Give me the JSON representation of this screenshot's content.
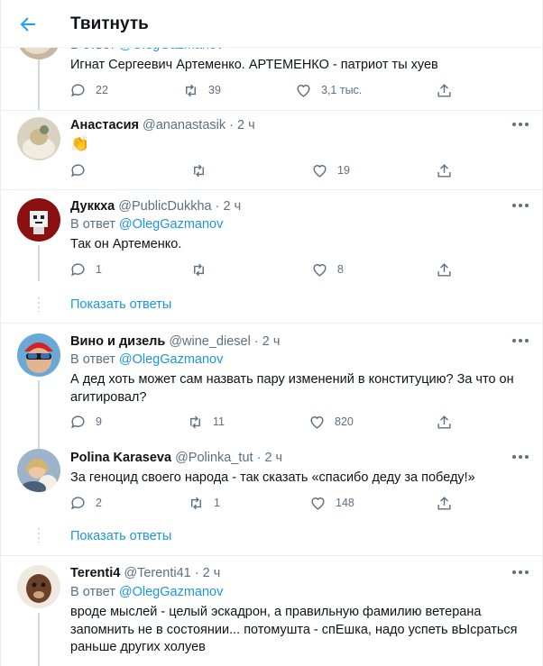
{
  "header": {
    "title": "Твитнуть"
  },
  "colors": {
    "accent": "#1da1f2",
    "link": "#1b95e0",
    "muted": "#5b7083",
    "text": "#0f1419",
    "border": "#ebeef0"
  },
  "icons": {
    "back": "arrow-left-icon",
    "more": "ellipsis-icon",
    "reply": "speech-bubble-icon",
    "retweet": "retweet-icon",
    "like": "heart-icon",
    "share": "share-icon"
  },
  "tweets": [
    {
      "reply_label": "В ответ",
      "reply_to": "@OlegGazmanov",
      "text": "Игнат Сергеевич Артеменко. АРТЕМЕНКО - патриот ты хуев",
      "replies": "22",
      "retweets": "39",
      "likes": "3,1 тыс."
    },
    {
      "name": "Анастасия",
      "handle": "@ananastasik",
      "time": "2 ч",
      "text": "👏",
      "replies": "",
      "retweets": "",
      "likes": "19"
    },
    {
      "name": "Дуккха",
      "handle": "@PublicDukkha",
      "time": "2 ч",
      "reply_label": "В ответ",
      "reply_to": "@OlegGazmanov",
      "text": "Так он Артеменко.",
      "replies": "1",
      "retweets": "",
      "likes": "8"
    },
    {
      "name": "Вино и дизель",
      "handle": "@wine_diesel",
      "time": "2 ч",
      "reply_label": "В ответ",
      "reply_to": "@OlegGazmanov",
      "text_lines": [
        "А дед хоть может сам назвать пару изменений в конституцию? За что он",
        "агитировал?"
      ],
      "replies": "9",
      "retweets": "11",
      "likes": "820"
    },
    {
      "name": "Polina Karaseva",
      "handle": "@Polinka_tut",
      "time": "2 ч",
      "text": "За геноцид своего народа - так сказать «спасибо деду за победу!»",
      "replies": "2",
      "retweets": "1",
      "likes": "148"
    },
    {
      "name": "Terenti4",
      "handle": "@Terenti41",
      "time": "2 ч",
      "reply_label": "В ответ",
      "reply_to": "@OlegGazmanov",
      "text_lines": [
        "вроде мыслей - целый эскадрон, а правильную фамилию  ветерана",
        "запомнить не в состоянии... потомушта - спЕшка, надо успеть вЫсраться",
        "раньше других холуев"
      ]
    }
  ],
  "show_replies_label": "Показать ответы",
  "dot": "·"
}
